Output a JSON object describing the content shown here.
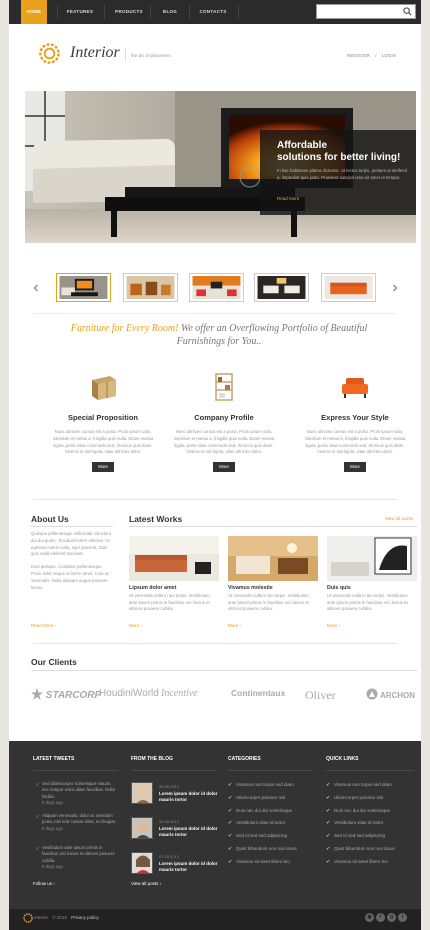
{
  "nav": {
    "items": [
      "HOME",
      "FEATURES",
      "PRODUCTS",
      "BLOG",
      "CONTACTS"
    ],
    "active_index": 0
  },
  "header": {
    "logo": "Interior",
    "tagline": "the art of placement",
    "register": "REGISTER",
    "login": "LOGIN",
    "sep": "/"
  },
  "hero": {
    "title_line1": "Affordable",
    "title_line2": "solutions for better living!",
    "text": "In hac habitasse platea dictumst. Ut lectus turpis, pretium ut eleifend a, imperdiet quis justo. Praesent suscipit urna sit amet ut tempor.",
    "more": "Read More"
  },
  "headline": {
    "highlight": "Furniture for Every Room!",
    "rest": "We offer an Overflowing Portfolio of Beautiful Furnishings for You.."
  },
  "features": [
    {
      "title": "Special Proposition",
      "text": "Nunc ultricies cursus est a porta. Proin ipsum odio, interdum et metus a, fringilla quis nulla. Etiam massa ligula, porta vitae commodo sed, rhoncus quis diam. Viverra et nisl ligula, vitae ultricies dolor.",
      "button": "More"
    },
    {
      "title": "Company Profile",
      "text": "Nunc ultricies cursus est a porta. Proin ipsum odio, interdum et metus a, fringilla quis nulla. Etiam massa ligula, porta vitae commodo sed, rhoncus quis diam. Viverra et nisl ligula, vitae ultricies dolor.",
      "button": "More"
    },
    {
      "title": "Express Your Style",
      "text": "Nunc ultricies cursus est a porta. Proin ipsum odio, interdum et metus a, fringilla quis nulla. Etiam massa ligula, porta vitae commodo sed, rhoncus quis diam. Viverra et nisl ligula, vitae ultricies dolor.",
      "button": "More"
    }
  ],
  "about": {
    "title": "About Us",
    "p1": "Quisque pellentesque sollicitudin tincidunt dui dui quam. Tincidunt lorem ultricies. Ut egestas metus nulla, eget placerat. Duis quis nulla eleifend tincidunt.",
    "p2": "Duis quisque. Curabitur pellentesque. Proin dolor neque id lorem amet. Cras ac venenatis. Nulla aliquam augue posuere lectus.",
    "more": "Read More"
  },
  "works": {
    "title": "Latest Works",
    "view_all": "View all works",
    "items": [
      {
        "title": "Lipsum dolor amet",
        "text": "Ut venenatis nulla in leo turpis. Vestibulum ante ipsum primis in faucibus orci luctus et ultrices posuere cubilia.",
        "more": "More"
      },
      {
        "title": "Vivamus molestie",
        "text": "Ut venenatis nulla in leo turpis. Vestibulum ante ipsum primis in faucibus orci luctus et ultrices posuere cubilia.",
        "more": "More"
      },
      {
        "title": "Duis quis",
        "text": "Ut venenatis nulla in leo turpis. Vestibulum ante ipsum primis in faucibus orci luctus et ultrices posuere cubilia.",
        "more": "More"
      }
    ]
  },
  "clients": {
    "title": "Our Clients",
    "items": [
      "STARCORP",
      "HoudiniWorld",
      "Incentive",
      "Continentaux",
      "Oliver",
      "ARCHON"
    ]
  },
  "footer": {
    "tweets_title": "LATEST TWEETS",
    "tweets": [
      {
        "text": "Sed ullamcorper scelerisque mauris, nec tempor enim ullam faucibus. Nulla facilisi.",
        "ago": "5 days ago"
      },
      {
        "text": "Aliquam venenatis, dolor ac interdum porta, nisl erat cursus dolor, eu feugiat.",
        "ago": "6 days ago"
      },
      {
        "text": "Vestibulum ante ipsum primis in faucibus orci luctus et ultrices posuere cubilia.",
        "ago": "6 days ago"
      }
    ],
    "follow": "Follow us",
    "blog_title": "FROM THE BLOG",
    "blog": [
      {
        "date": "05.06.2012",
        "title": "Lorem ipsum dolor id dolor mauris tortor"
      },
      {
        "date": "06.05.2012",
        "title": "Lorem ipsum dolor id dolor mauris tortor"
      },
      {
        "date": "07.05.2012",
        "title": "Lorem ipsum dolor id dolor mauris tortor"
      }
    ],
    "view_posts": "View all posts",
    "categories_title": "CATEGORIES",
    "categories": [
      "Vivamus non turpis sed diam",
      "Ullamcorper pulvinar nisl",
      "Duis nec dui dui scelerisque",
      "Vestibulum vitae id tortor",
      "Sed id sed sed adipiscing",
      "Quist bibendum non non lacus",
      "Vivamus sit amet libero leo"
    ],
    "quick_title": "QUICK LINKS",
    "quick": [
      "Vivamus non turpis sed diam",
      "Ullamcorper pulvinar nisl",
      "Duis nec dui dui scelerisque",
      "Vestibulum vitae id tortor",
      "Sed id sed sed adipiscing",
      "Quist bibendum non non lacus",
      "Vivamus sit amet libero leo"
    ],
    "bottom_logo": "Interior",
    "copyright": "© 2012",
    "privacy": "Privacy policy"
  },
  "search": {
    "placeholder": ""
  }
}
